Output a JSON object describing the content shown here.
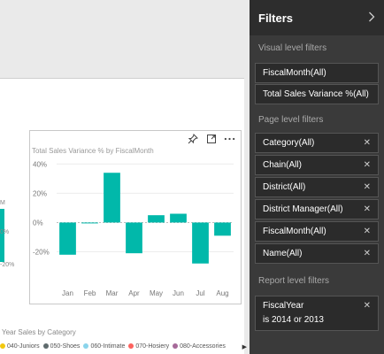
{
  "report": {
    "left_label": "M",
    "left_ticks": [
      "0%",
      "-20%"
    ],
    "visual": {
      "title": "Total Sales Variance % by FiscalMonth",
      "icons": [
        "pin-icon",
        "expand-icon",
        "more-icon"
      ]
    },
    "legend_title": "Year Sales by Category",
    "legend": [
      {
        "label": "040-Juniors",
        "color": "#f2c80f"
      },
      {
        "label": "050-Shoes",
        "color": "#5f6b6d"
      },
      {
        "label": "060-Intimate",
        "color": "#8ad4eb"
      },
      {
        "label": "070-Hosiery",
        "color": "#fd625e"
      },
      {
        "label": "080-Accessories",
        "color": "#a66999"
      }
    ]
  },
  "chart_data": {
    "type": "bar",
    "title": "Total Sales Variance % by FiscalMonth",
    "categories": [
      "Jan",
      "Feb",
      "Mar",
      "Apr",
      "May",
      "Jun",
      "Jul",
      "Aug"
    ],
    "values": [
      -22,
      0,
      34,
      -21,
      5,
      6,
      -28,
      -9
    ],
    "yticks": [
      "40%",
      "20%",
      "0%",
      "-20%"
    ],
    "ylim": [
      -33,
      42
    ],
    "color": "#01b8aa",
    "grid": true
  },
  "filters": {
    "title": "Filters",
    "visual_level_label": "Visual level filters",
    "visual_level": [
      "FiscalMonth(All)",
      "Total Sales Variance %(All)"
    ],
    "page_level_label": "Page level filters",
    "page_level": [
      "Category(All)",
      "Chain(All)",
      "District(All)",
      "District Manager(All)",
      "FiscalMonth(All)",
      "Name(All)"
    ],
    "report_level_label": "Report level filters",
    "report_level": {
      "line1": "FiscalYear",
      "line2": "is 2014 or 2013"
    },
    "remove_glyph": "✕"
  }
}
